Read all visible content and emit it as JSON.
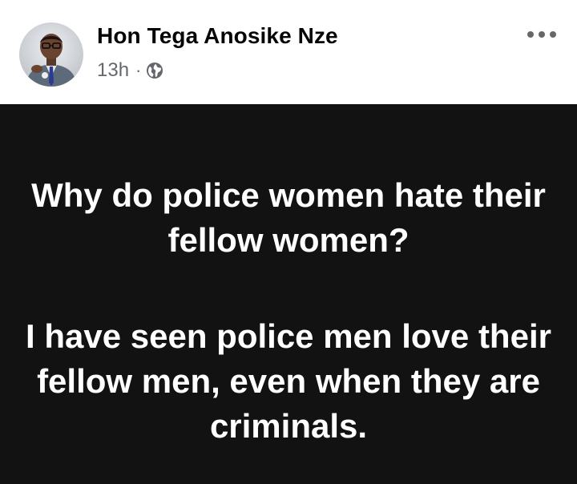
{
  "post": {
    "author": "Hon Tega Anosike Nze",
    "time": "13h",
    "separator": "·",
    "privacy_icon": "globe-icon",
    "more_icon": "more-options-icon"
  },
  "content": {
    "background": "#121212",
    "text_color": "#ffffff",
    "paragraphs": [
      "Why do police women hate their fellow women?",
      "I have seen police men love their fellow men, even when they are criminals."
    ]
  }
}
